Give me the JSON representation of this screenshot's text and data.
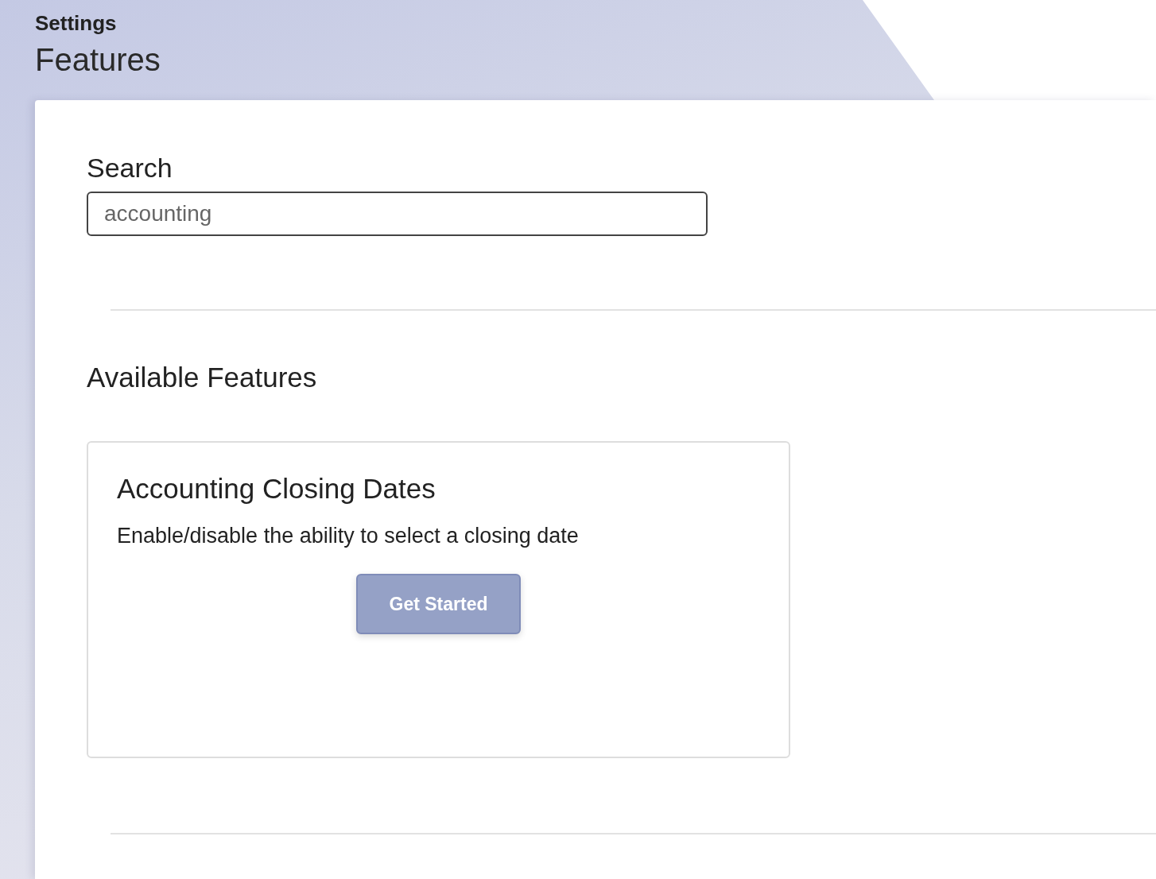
{
  "header": {
    "breadcrumb": "Settings",
    "title": "Features"
  },
  "search": {
    "label": "Search",
    "value": "accounting"
  },
  "section": {
    "title": "Available Features"
  },
  "features": [
    {
      "title": "Accounting Closing Dates",
      "description": "Enable/disable the ability to select a closing date",
      "button": "Get Started"
    }
  ]
}
